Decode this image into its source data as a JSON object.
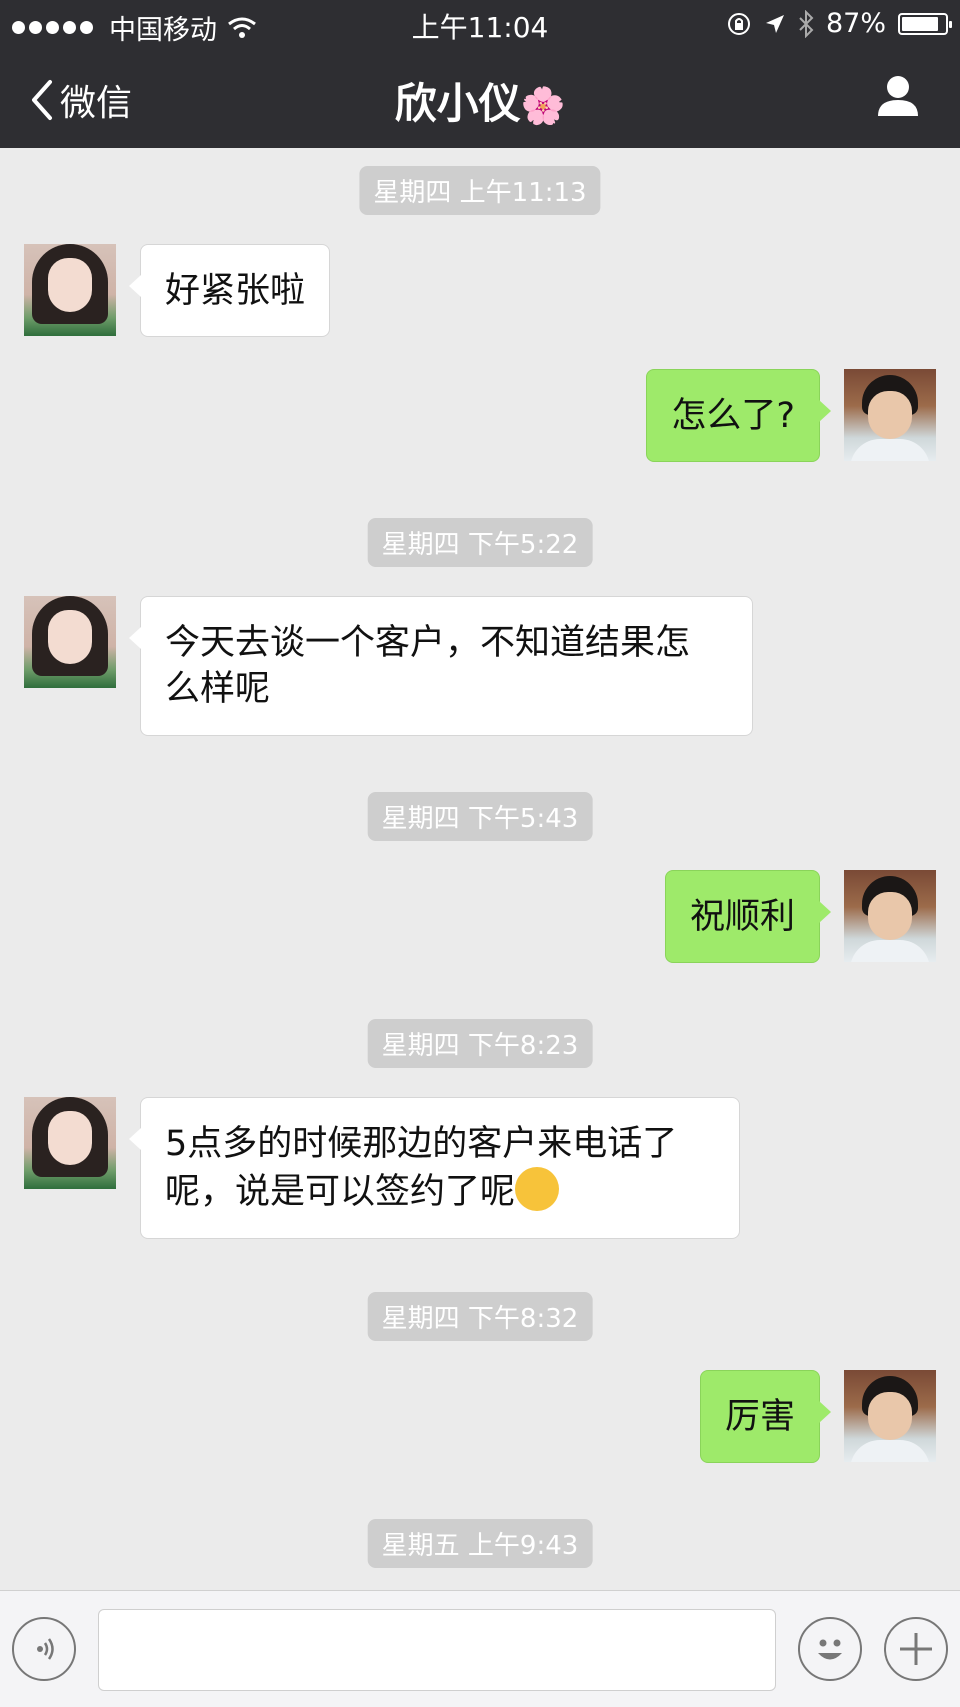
{
  "status": {
    "carrier": "中国移动",
    "time": "上午11:04",
    "battery": "87%",
    "battery_level": 0.87
  },
  "nav": {
    "back_label": "微信",
    "title": "欣小仪",
    "title_emoji": "🌸"
  },
  "messages": [
    {
      "type": "timestamp",
      "text": "星期四 上午11:13"
    },
    {
      "type": "received",
      "text": "好紧张啦"
    },
    {
      "type": "sent",
      "text": "怎么了?"
    },
    {
      "type": "timestamp",
      "text": "星期四 下午5:22"
    },
    {
      "type": "received",
      "line1": "今天去谈一个客户，不知道结果怎",
      "line2": "么样呢"
    },
    {
      "type": "timestamp",
      "text": "星期四 下午5:43"
    },
    {
      "type": "sent",
      "text": "祝顺利"
    },
    {
      "type": "timestamp",
      "text": "星期四 下午8:23"
    },
    {
      "type": "received",
      "line1": "5点多的时候那边的客户来电话了",
      "line2": "呢，说是可以签约了呢",
      "emoji": "hugging-face-emoji"
    },
    {
      "type": "timestamp",
      "text": "星期四 下午8:32"
    },
    {
      "type": "sent",
      "text": "厉害"
    },
    {
      "type": "timestamp",
      "text": "星期五 上午9:43"
    }
  ],
  "input": {
    "value": "",
    "placeholder": ""
  },
  "icons": [
    "back-chevron-icon",
    "profile-icon",
    "voice-icon",
    "emoji-icon",
    "plus-icon",
    "wifi-icon",
    "location-icon",
    "bluetooth-icon",
    "lock-rotation-icon"
  ],
  "colors": {
    "bar": "#2e2e32",
    "chat_bg": "#ebebeb",
    "sent_bubble": "#9eea6a",
    "received_bubble": "#ffffff"
  }
}
